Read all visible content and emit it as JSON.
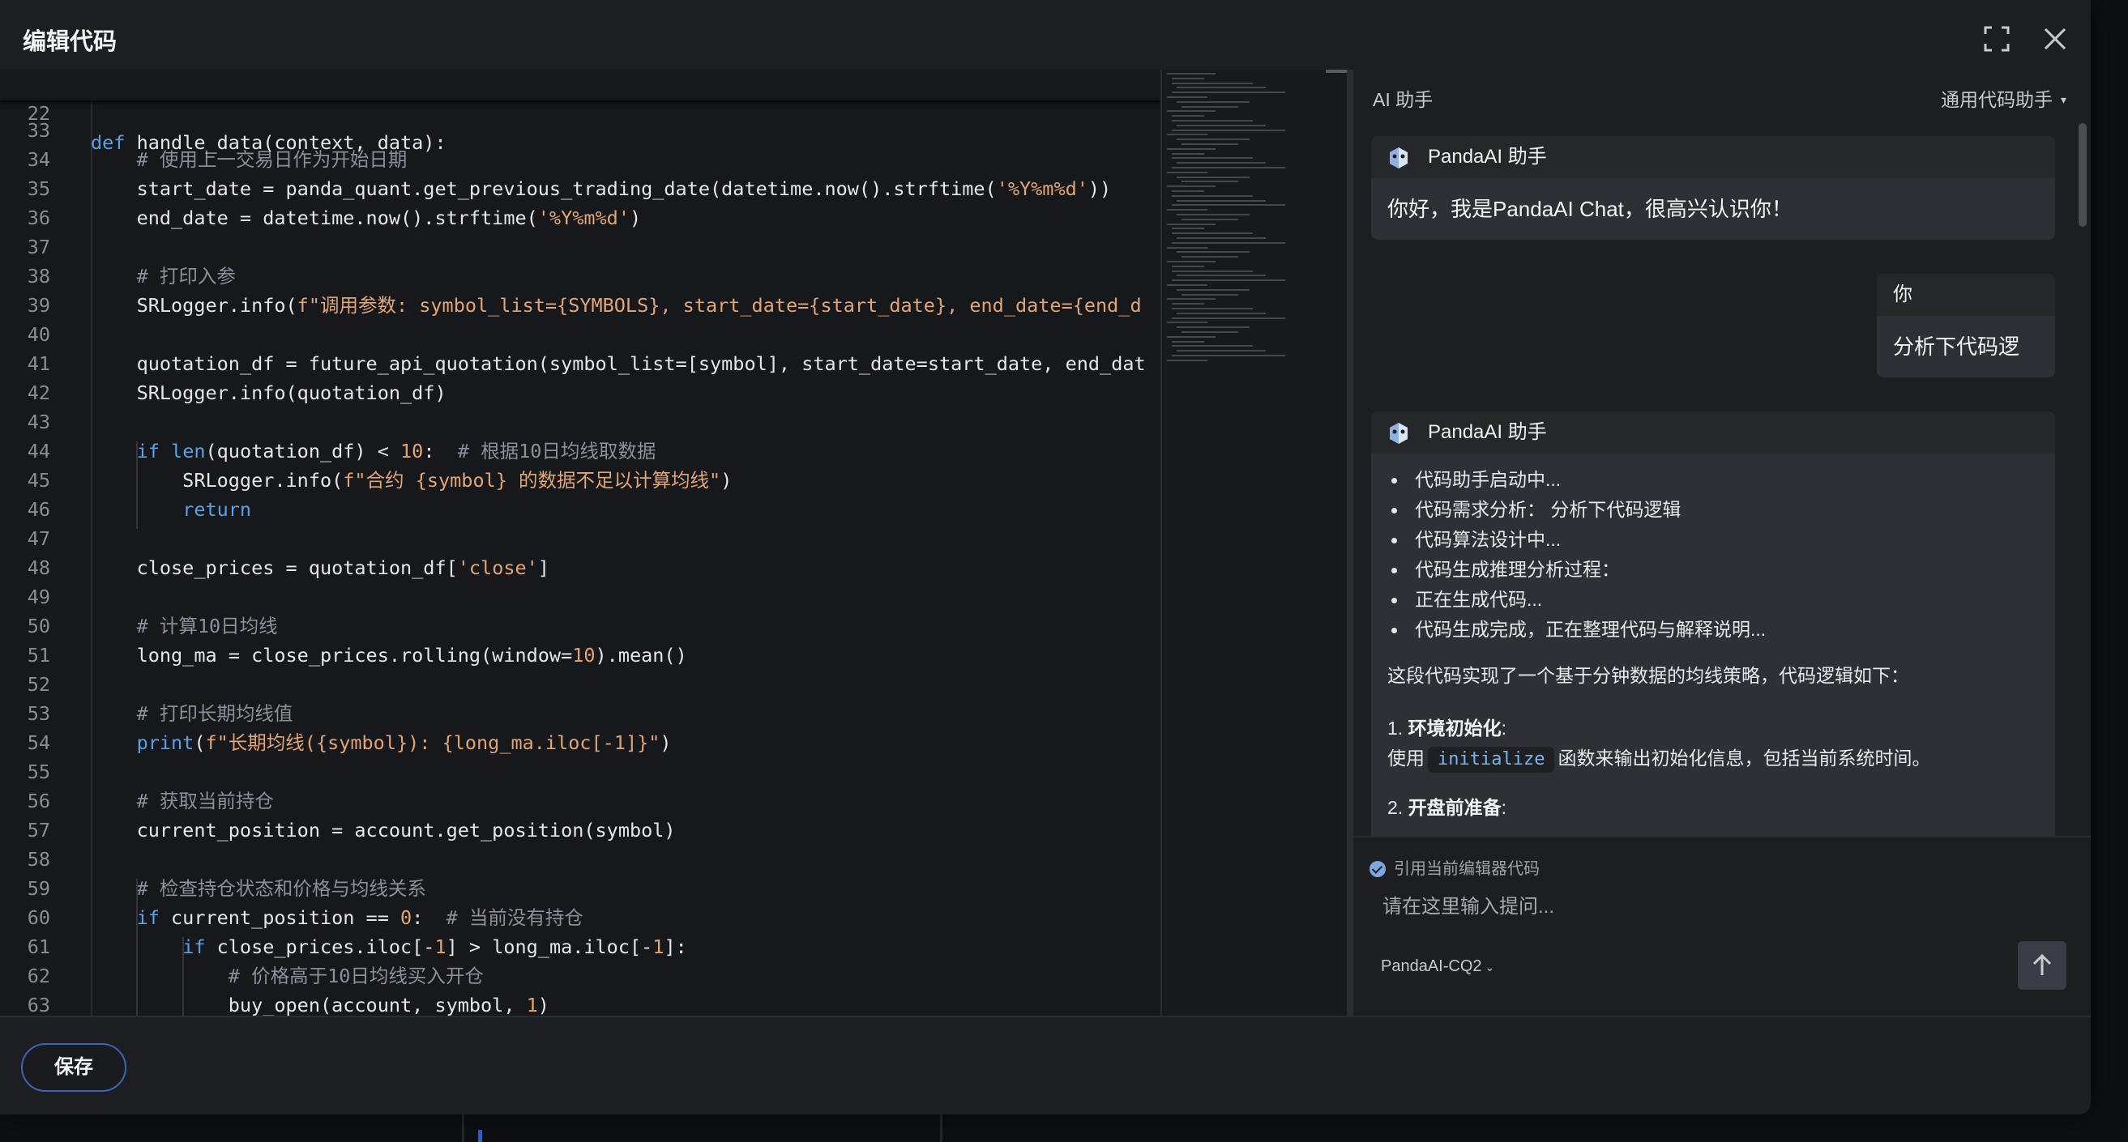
{
  "dialog": {
    "title": "编辑代码"
  },
  "editor": {
    "sticky": {
      "line": "22",
      "text": "def handle_data(context, data):"
    },
    "lines": [
      {
        "n": "33",
        "t": ""
      },
      {
        "n": "34",
        "t": "    # 使用上一交易日作为开始日期"
      },
      {
        "n": "35",
        "t": "    start_date = panda_quant.get_previous_trading_date(datetime.now().strftime('%Y%m%d'))"
      },
      {
        "n": "36",
        "t": "    end_date = datetime.now().strftime('%Y%m%d')"
      },
      {
        "n": "37",
        "t": ""
      },
      {
        "n": "38",
        "t": "    # 打印入参"
      },
      {
        "n": "39",
        "t": "    SRLogger.info(f\"调用参数: symbol_list={SYMBOLS}, start_date={start_date}, end_date={end_d"
      },
      {
        "n": "40",
        "t": ""
      },
      {
        "n": "41",
        "t": "    quotation_df = future_api_quotation(symbol_list=[symbol], start_date=start_date, end_dat"
      },
      {
        "n": "42",
        "t": "    SRLogger.info(quotation_df)"
      },
      {
        "n": "43",
        "t": ""
      },
      {
        "n": "44",
        "t": "    if len(quotation_df) < 10:  # 根据10日均线取数据"
      },
      {
        "n": "45",
        "t": "        SRLogger.info(f\"合约 {symbol} 的数据不足以计算均线\")"
      },
      {
        "n": "46",
        "t": "        return"
      },
      {
        "n": "47",
        "t": ""
      },
      {
        "n": "48",
        "t": "    close_prices = quotation_df['close']"
      },
      {
        "n": "49",
        "t": ""
      },
      {
        "n": "50",
        "t": "    # 计算10日均线"
      },
      {
        "n": "51",
        "t": "    long_ma = close_prices.rolling(window=10).mean()"
      },
      {
        "n": "52",
        "t": ""
      },
      {
        "n": "53",
        "t": "    # 打印长期均线值"
      },
      {
        "n": "54",
        "t": "    print(f\"长期均线({symbol}): {long_ma.iloc[-1]}\")"
      },
      {
        "n": "55",
        "t": ""
      },
      {
        "n": "56",
        "t": "    # 获取当前持仓"
      },
      {
        "n": "57",
        "t": "    current_position = account.get_position(symbol)"
      },
      {
        "n": "58",
        "t": ""
      },
      {
        "n": "59",
        "t": "    # 检查持仓状态和价格与均线关系"
      },
      {
        "n": "60",
        "t": "    if current_position == 0:  # 当前没有持仓"
      },
      {
        "n": "61",
        "t": "        if close_prices.iloc[-1] > long_ma.iloc[-1]:"
      },
      {
        "n": "62",
        "t": "            # 价格高于10日均线买入开仓"
      },
      {
        "n": "63",
        "t": "            buy_open(account, symbol, 1)"
      }
    ]
  },
  "ai_panel": {
    "title": "AI 助手",
    "mode": "通用代码助手",
    "assistant_name": "PandaAI 助手",
    "user_name": "你",
    "greeting": "你好，我是PandaAI Chat，很高兴认识你！",
    "user_message": "分析下代码逻辑",
    "steps": [
      "代码助手启动中...",
      "代码需求分析： 分析下代码逻辑",
      "代码算法设计中...",
      "代码生成推理分析过程：",
      "正在生成代码...",
      "代码生成完成，正在整理代码与解释说明..."
    ],
    "summary": "这段代码实现了一个基于分钟数据的均线策略，代码逻辑如下：",
    "item1_num": "1.",
    "item1_title": "环境初始化",
    "item1_colon": ":",
    "item1_pre": "使用",
    "item1_code": "initialize",
    "item1_post": "函数来输出初始化信息，包括当前系统时间。",
    "item2_num": "2.",
    "item2_title": "开盘前准备",
    "item2_colon": ":",
    "reference_label": "引用当前编辑器代码",
    "input_placeholder": "请在这里输入提问...",
    "model": "PandaAI-CQ2"
  },
  "footer": {
    "save_label": "保存"
  },
  "colors": {
    "accent": "#3b64b5",
    "keyword": "#5aa0e6",
    "string": "#e0a476",
    "comment": "#8a8f98"
  },
  "icons": [
    "fullscreen-icon",
    "close-icon",
    "panda-avatar-icon",
    "check-circle-icon",
    "send-arrow-icon",
    "chevron-down-icon"
  ]
}
